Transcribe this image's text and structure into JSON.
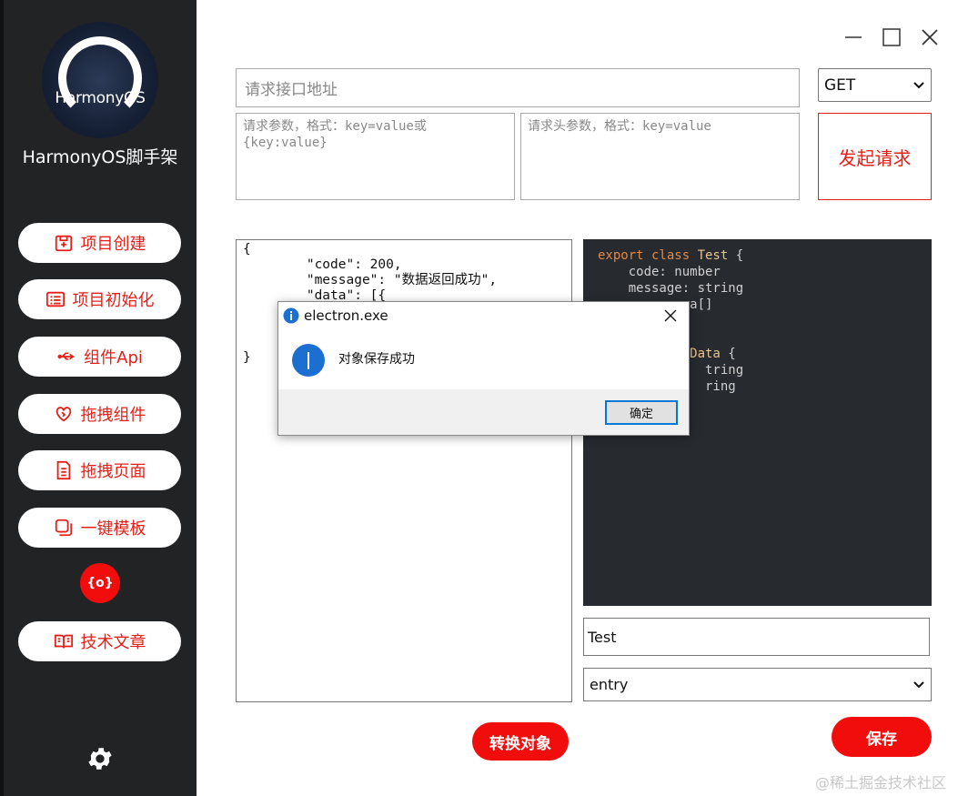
{
  "sidebar": {
    "logo_text": "HarmonyOS",
    "app_title": "HarmonyOS脚手架",
    "items": [
      {
        "label": "项目创建",
        "icon": "add-box-icon"
      },
      {
        "label": "项目初始化",
        "icon": "list-icon"
      },
      {
        "label": "组件Api",
        "icon": "usb-icon"
      },
      {
        "label": "拖拽组件",
        "icon": "puzzle-heart-icon"
      },
      {
        "label": "拖拽页面",
        "icon": "document-icon"
      },
      {
        "label": "一键模板",
        "icon": "copy-icon"
      }
    ],
    "json_tool_label": "{o}",
    "article_label": "技术文章",
    "settings_icon": "gear-icon"
  },
  "request": {
    "url_placeholder": "请求接口地址",
    "method": "GET",
    "params_placeholder": "请求参数，格式：key=value或{key:value}",
    "headers_placeholder": "请求头参数，格式：key=value",
    "send_label": "发起请求"
  },
  "json_text": "{\n        \"code\": 200,\n        \"message\": \"数据返回成功\",\n        \"data\": [{\n\n\n\n}",
  "code_lines": [
    {
      "parts": [
        [
          "kw",
          "export class "
        ],
        [
          "cls",
          "Test"
        ],
        [
          "txt",
          " {"
        ]
      ]
    },
    {
      "parts": [
        [
          "txt",
          "    code: number"
        ]
      ]
    },
    {
      "parts": [
        [
          "txt",
          "    message: string"
        ]
      ]
    },
    {
      "parts": [
        [
          "txt",
          "            a[]"
        ]
      ]
    },
    {
      "parts": [
        [
          "txt",
          ""
        ]
      ]
    },
    {
      "parts": [
        [
          "txt",
          ""
        ]
      ]
    },
    {
      "parts": [
        [
          "cls",
          "            Data"
        ],
        [
          "txt",
          " {"
        ]
      ]
    },
    {
      "parts": [
        [
          "txt",
          "              tring"
        ]
      ]
    },
    {
      "parts": [
        [
          "txt",
          "              ring"
        ]
      ]
    }
  ],
  "class_name": "Test",
  "module": "entry",
  "convert_label": "转换对象",
  "save_label": "保存",
  "dialog": {
    "title": "electron.exe",
    "message": "对象保存成功",
    "ok_label": "确定"
  },
  "watermark": "@稀土掘金技术社区",
  "colors": {
    "accent": "#e5201a",
    "button_red": "#f20d0d",
    "sidebar": "#222325",
    "code_bg": "#272a2f"
  }
}
